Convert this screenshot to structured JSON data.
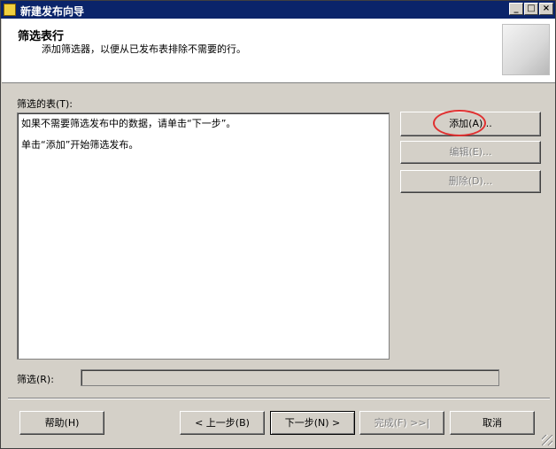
{
  "window": {
    "title": "新建发布向导",
    "minimize": "_",
    "maximize": "□",
    "close": "×"
  },
  "header": {
    "title": "筛选表行",
    "subtitle": "添加筛选器，以便从已发布表排除不需要的行。"
  },
  "filtered_tables": {
    "label": "筛选的表(T):",
    "lines": [
      "如果不需要筛选发布中的数据，请单击“下一步”。",
      "单击“添加”开始筛选发布。"
    ]
  },
  "side_buttons": {
    "add": "添加(A)...",
    "edit": "编辑(E)...",
    "delete": "删除(D)..."
  },
  "filter": {
    "label": "筛选(R):",
    "value": ""
  },
  "footer": {
    "help": "帮助(H)",
    "back": "< 上一步(B)",
    "next": "下一步(N) >",
    "finish": "完成(F) >>|",
    "cancel": "取消"
  }
}
